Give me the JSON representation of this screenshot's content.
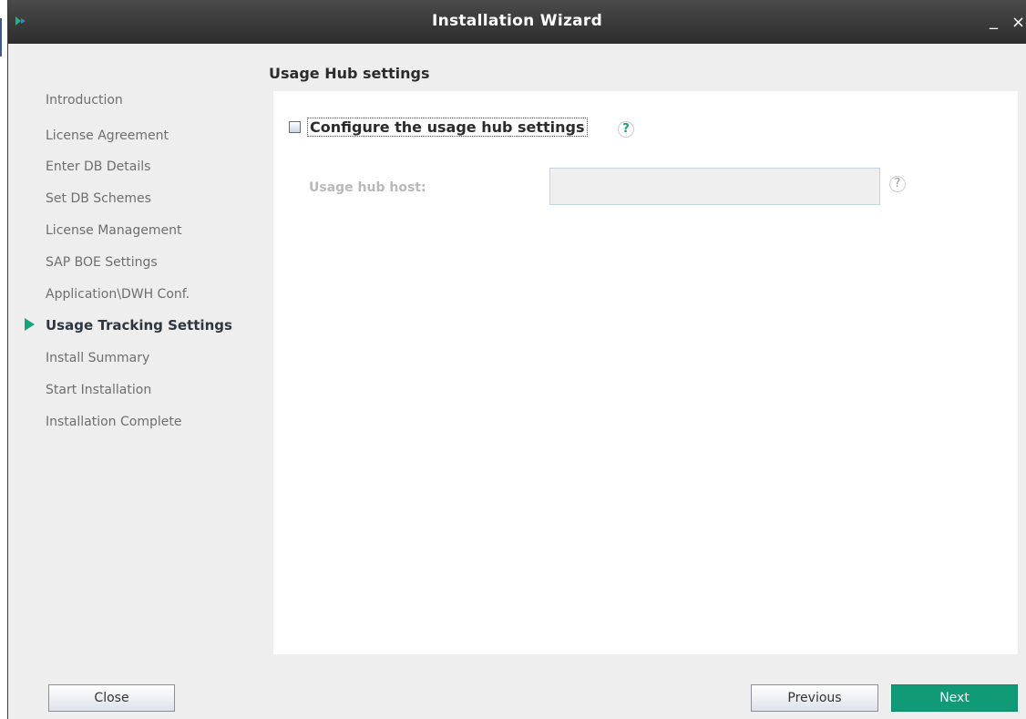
{
  "window": {
    "title": "Installation Wizard",
    "minimize_glyph": "_",
    "close_glyph": "×"
  },
  "page": {
    "heading": "Usage Hub settings"
  },
  "steps": [
    {
      "label": "Introduction",
      "current": false
    },
    {
      "label": "License Agreement",
      "current": false
    },
    {
      "label": "Enter DB Details",
      "current": false
    },
    {
      "label": "Set DB Schemes",
      "current": false
    },
    {
      "label": "License Management",
      "current": false
    },
    {
      "label": "SAP BOE Settings",
      "current": false
    },
    {
      "label": "Application\\DWH Conf.",
      "current": false
    },
    {
      "label": "Usage Tracking Settings",
      "current": true
    },
    {
      "label": "Install Summary",
      "current": false
    },
    {
      "label": "Start Installation",
      "current": false
    },
    {
      "label": "Installation Complete",
      "current": false
    }
  ],
  "form": {
    "configure_checkbox": {
      "label": "Configure the usage hub settings",
      "checked": false
    },
    "help_glyph": "?",
    "host": {
      "label": "Usage hub host:",
      "value": "",
      "enabled": false
    }
  },
  "buttons": {
    "close": "Close",
    "previous": "Previous",
    "next": "Next"
  },
  "colors": {
    "accent": "#119a76",
    "titlebar": "#333333",
    "step_inactive": "#6e6e6e"
  },
  "icons": {
    "app": "app-logo-icon",
    "current_step": "play-arrow-icon",
    "help": "help-question-icon"
  }
}
